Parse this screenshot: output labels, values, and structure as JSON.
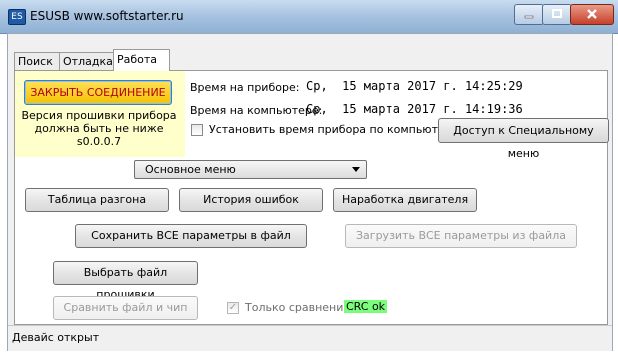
{
  "window": {
    "icon_text": "ES",
    "title": "ESUSB  www.softstarter.ru"
  },
  "tabs": [
    {
      "label": "Поиск"
    },
    {
      "label": "Отладка"
    },
    {
      "label": "Работа",
      "active": true
    }
  ],
  "work": {
    "close_connection_label": "ЗАКРЫТЬ СОЕДИНЕНИЕ",
    "firmware_notice": [
      "Версия прошивки прибора",
      "должна быть не ниже",
      "s0.0.0.7"
    ],
    "device_time_label": "Время на приборе:",
    "device_time_value": "Ср,  15 марта 2017 г. 14:25:29",
    "computer_time_label": "Время на компьютере:",
    "computer_time_value": "Ср,  15 марта 2017 г. 14:19:36",
    "set_time_checkbox_label": "Установить время прибора по компьютеру",
    "set_time_checked": false,
    "special_menu_button": "Доступ к Специальному меню",
    "menu_select_value": "Основное меню",
    "accel_table_button": "Таблица разгона",
    "error_history_button": "История ошибок",
    "motor_hours_button": "Наработка двигателя",
    "save_all_button": "Сохранить ВСЕ параметры в файл",
    "load_all_button": "Загрузить ВСЕ параметры из файла",
    "select_firmware_button": "Выбрать файл прошивки",
    "compare_button": "Сравнить файл и чип",
    "compare_only_label": "Только сравнение",
    "compare_only_checked": true,
    "crc_status": "CRC ok",
    "crc_color": "#7cfc7c"
  },
  "status": {
    "text": "Девайс открыт"
  }
}
